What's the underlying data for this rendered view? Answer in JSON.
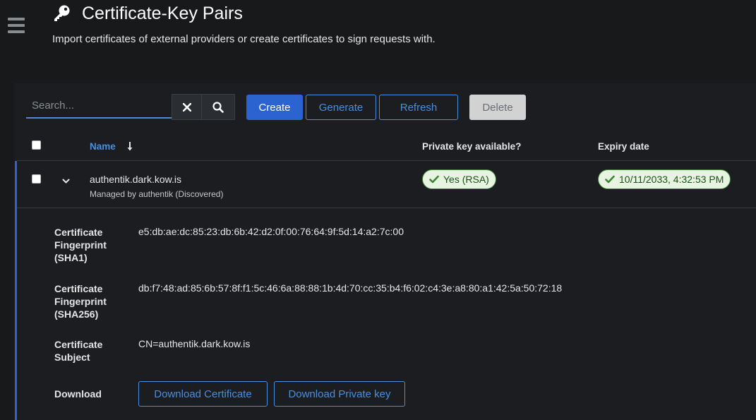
{
  "header": {
    "title": "Certificate-Key Pairs",
    "description": "Import certificates of external providers or create certificates to sign requests with.",
    "icon": "key-icon",
    "menu_icon": "hamburger-menu-icon"
  },
  "toolbar": {
    "search_placeholder": "Search...",
    "clear_icon": "close-icon",
    "search_icon": "search-icon",
    "create_label": "Create",
    "generate_label": "Generate",
    "refresh_label": "Refresh",
    "delete_label": "Delete"
  },
  "table": {
    "columns": [
      "Name",
      "Private key available?",
      "Expiry date"
    ],
    "sort_icon": "sort-arrow-down-icon",
    "rows": [
      {
        "name": "authentik.dark.kow.is",
        "subtitle": "Managed by authentik (Discovered)",
        "private_key": "Yes (RSA)",
        "expiry": "10/11/2033, 4:32:53 PM",
        "expanded": true,
        "details": {
          "sha1_label": "Certificate Fingerprint (SHA1)",
          "sha1_value": "e5:db:ae:dc:85:23:db:6b:42:d2:0f:00:76:64:9f:5d:14:a2:7c:00",
          "sha256_label": "Certificate Fingerprint (SHA256)",
          "sha256_value": "db:f7:48:ad:85:6b:57:8f:f1:5c:46:6a:88:88:1b:4d:70:cc:35:b4:f6:02:c4:3e:a8:80:a1:42:5a:50:72:18",
          "subject_label": "Certificate Subject",
          "subject_value": "CN=authentik.dark.kow.is",
          "download_label": "Download",
          "download_cert_label": "Download Certificate",
          "download_key_label": "Download Private key"
        }
      }
    ]
  },
  "colors": {
    "background": "#18191a",
    "accent": "#2b64d1",
    "link": "#4c8ede",
    "success": "#3e8635"
  }
}
